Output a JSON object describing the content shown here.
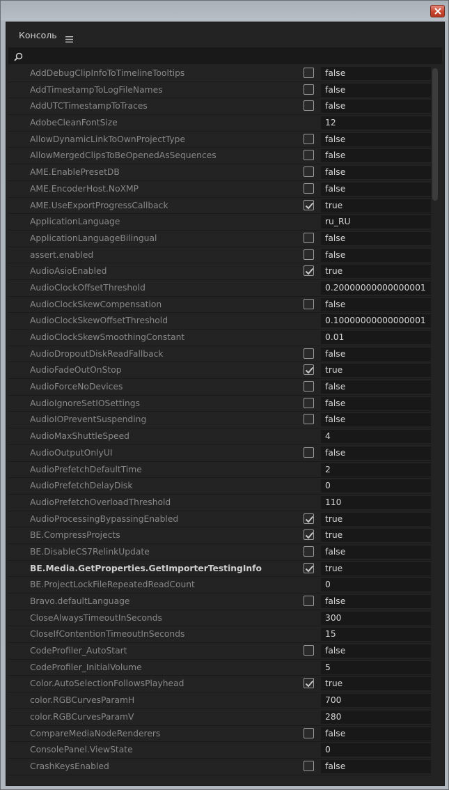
{
  "window": {
    "close_icon": "close-icon",
    "accent": "#c7452f"
  },
  "panel": {
    "title": "Консоль",
    "menu_icon": "hamburger-menu-icon"
  },
  "search": {
    "placeholder": "",
    "icon": "search-icon"
  },
  "rows": [
    {
      "name": "AddDebugClipInfoToTimelineTooltips",
      "checkbox": true,
      "checked": false,
      "value": "false"
    },
    {
      "name": "AddTimestampToLogFileNames",
      "checkbox": true,
      "checked": false,
      "value": "false"
    },
    {
      "name": "AddUTCTimestampToTraces",
      "checkbox": true,
      "checked": false,
      "value": "false"
    },
    {
      "name": "AdobeCleanFontSize",
      "checkbox": false,
      "checked": false,
      "value": "12"
    },
    {
      "name": "AllowDynamicLinkToOwnProjectType",
      "checkbox": true,
      "checked": false,
      "value": "false"
    },
    {
      "name": "AllowMergedClipsToBeOpenedAsSequences",
      "checkbox": true,
      "checked": false,
      "value": "false"
    },
    {
      "name": "AME.EnablePresetDB",
      "checkbox": true,
      "checked": false,
      "value": "false"
    },
    {
      "name": "AME.EncoderHost.NoXMP",
      "checkbox": true,
      "checked": false,
      "value": "false"
    },
    {
      "name": "AME.UseExportProgressCallback",
      "checkbox": true,
      "checked": true,
      "value": "true"
    },
    {
      "name": "ApplicationLanguage",
      "checkbox": false,
      "checked": false,
      "value": "ru_RU"
    },
    {
      "name": "ApplicationLanguageBilingual",
      "checkbox": true,
      "checked": false,
      "value": "false"
    },
    {
      "name": "assert.enabled",
      "checkbox": true,
      "checked": false,
      "value": "false"
    },
    {
      "name": "AudioAsioEnabled",
      "checkbox": true,
      "checked": true,
      "value": "true"
    },
    {
      "name": "AudioClockOffsetThreshold",
      "checkbox": false,
      "checked": false,
      "value": "0.20000000000000001"
    },
    {
      "name": "AudioClockSkewCompensation",
      "checkbox": true,
      "checked": false,
      "value": "false"
    },
    {
      "name": "AudioClockSkewOffsetThreshold",
      "checkbox": false,
      "checked": false,
      "value": "0.10000000000000001"
    },
    {
      "name": "AudioClockSkewSmoothingConstant",
      "checkbox": false,
      "checked": false,
      "value": "0.01"
    },
    {
      "name": "AudioDropoutDiskReadFallback",
      "checkbox": true,
      "checked": false,
      "value": "false"
    },
    {
      "name": "AudioFadeOutOnStop",
      "checkbox": true,
      "checked": true,
      "value": "true"
    },
    {
      "name": "AudioForceNoDevices",
      "checkbox": true,
      "checked": false,
      "value": "false"
    },
    {
      "name": "AudioIgnoreSetIOSettings",
      "checkbox": true,
      "checked": false,
      "value": "false"
    },
    {
      "name": "AudioIOPreventSuspending",
      "checkbox": true,
      "checked": false,
      "value": "false"
    },
    {
      "name": "AudioMaxShuttleSpeed",
      "checkbox": false,
      "checked": false,
      "value": "4"
    },
    {
      "name": "AudioOutputOnlyUI",
      "checkbox": true,
      "checked": false,
      "value": "false"
    },
    {
      "name": "AudioPrefetchDefaultTime",
      "checkbox": false,
      "checked": false,
      "value": "2"
    },
    {
      "name": "AudioPrefetchDelayDisk",
      "checkbox": false,
      "checked": false,
      "value": "0"
    },
    {
      "name": "AudioPrefetchOverloadThreshold",
      "checkbox": false,
      "checked": false,
      "value": "110"
    },
    {
      "name": "AudioProcessingBypassingEnabled",
      "checkbox": true,
      "checked": true,
      "value": "true"
    },
    {
      "name": "BE.CompressProjects",
      "checkbox": true,
      "checked": true,
      "value": "true"
    },
    {
      "name": "BE.DisableCS7RelinkUpdate",
      "checkbox": true,
      "checked": false,
      "value": "false"
    },
    {
      "name": "BE.Media.GetProperties.GetImporterTestingInfo",
      "checkbox": true,
      "checked": true,
      "value": "true",
      "bold": true
    },
    {
      "name": "BE.ProjectLockFileRepeatedReadCount",
      "checkbox": false,
      "checked": false,
      "value": "0"
    },
    {
      "name": "Bravo.defaultLanguage",
      "checkbox": true,
      "checked": false,
      "value": "false"
    },
    {
      "name": "CloseAlwaysTimeoutInSeconds",
      "checkbox": false,
      "checked": false,
      "value": "300"
    },
    {
      "name": "CloseIfContentionTimeoutInSeconds",
      "checkbox": false,
      "checked": false,
      "value": "15"
    },
    {
      "name": "CodeProfiler_AutoStart",
      "checkbox": true,
      "checked": false,
      "value": "false"
    },
    {
      "name": "CodeProfiler_InitialVolume",
      "checkbox": false,
      "checked": false,
      "value": "5"
    },
    {
      "name": "Color.AutoSelectionFollowsPlayhead",
      "checkbox": true,
      "checked": true,
      "value": "true"
    },
    {
      "name": "color.RGBCurvesParamH",
      "checkbox": false,
      "checked": false,
      "value": "700"
    },
    {
      "name": "color.RGBCurvesParamV",
      "checkbox": false,
      "checked": false,
      "value": "280"
    },
    {
      "name": "CompareMediaNodeRenderers",
      "checkbox": true,
      "checked": false,
      "value": "false"
    },
    {
      "name": "ConsolePanel.ViewState",
      "checkbox": false,
      "checked": false,
      "value": "0"
    },
    {
      "name": "CrashKeysEnabled",
      "checkbox": true,
      "checked": false,
      "value": "false"
    }
  ],
  "scrollbar": {
    "position": 0
  }
}
